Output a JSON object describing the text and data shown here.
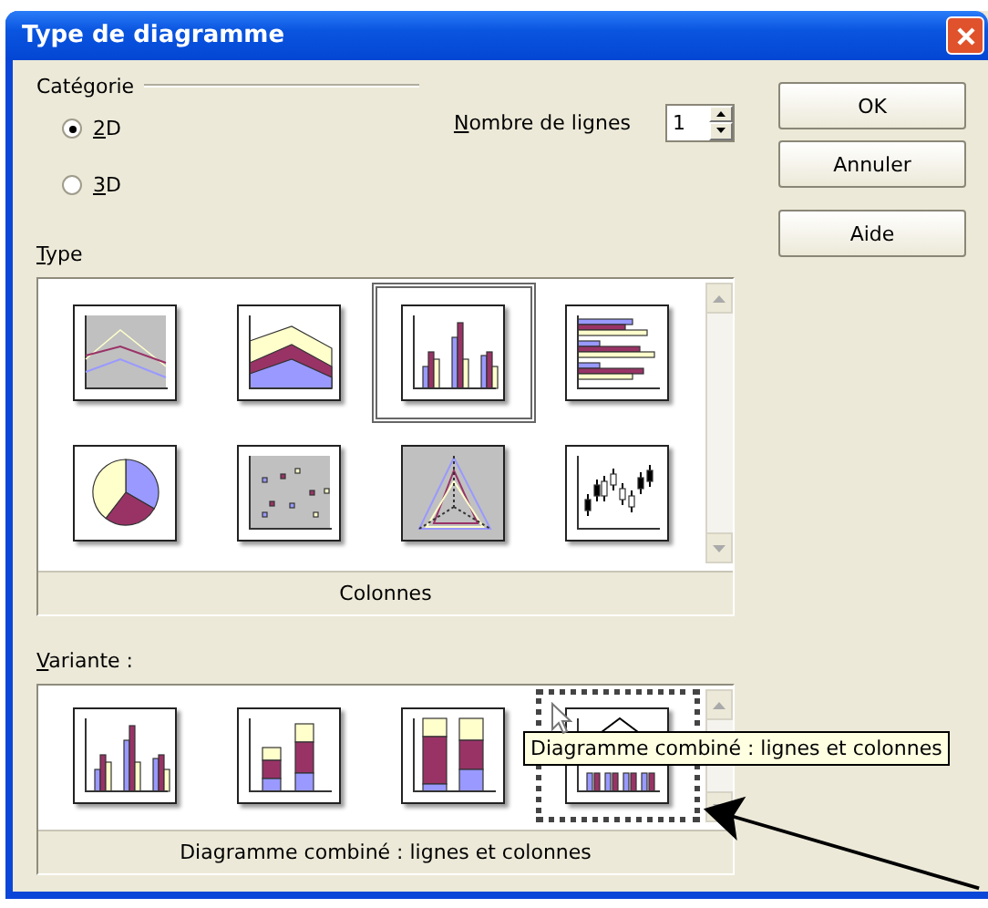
{
  "window": {
    "title": "Type de diagramme"
  },
  "category": {
    "label": "Catégorie",
    "options": [
      {
        "label": "2D",
        "selected": true
      },
      {
        "label": "3D",
        "selected": false
      }
    ]
  },
  "rows_field": {
    "label": "Nombre de lignes",
    "value": "1"
  },
  "buttons": [
    {
      "label": "OK"
    },
    {
      "label": "Annuler"
    },
    {
      "label": "Aide"
    }
  ],
  "type_list": {
    "label": "Type",
    "caption": "Colonnes",
    "items": [
      {
        "kind": "line",
        "selected": false
      },
      {
        "kind": "area",
        "selected": false
      },
      {
        "kind": "column",
        "selected": true
      },
      {
        "kind": "bar",
        "selected": false
      },
      {
        "kind": "pie",
        "selected": false
      },
      {
        "kind": "scatter",
        "selected": false
      },
      {
        "kind": "net",
        "selected": false
      },
      {
        "kind": "stock",
        "selected": false
      }
    ]
  },
  "variant_list": {
    "label": "Variante :",
    "caption": "Diagramme combiné : lignes et colonnes",
    "items": [
      {
        "kind": "column",
        "selected": false
      },
      {
        "kind": "stacked",
        "selected": false
      },
      {
        "kind": "percent",
        "selected": false
      },
      {
        "kind": "combined",
        "selected": true
      }
    ]
  },
  "tooltip": "Diagramme combiné : lignes et colonnes"
}
